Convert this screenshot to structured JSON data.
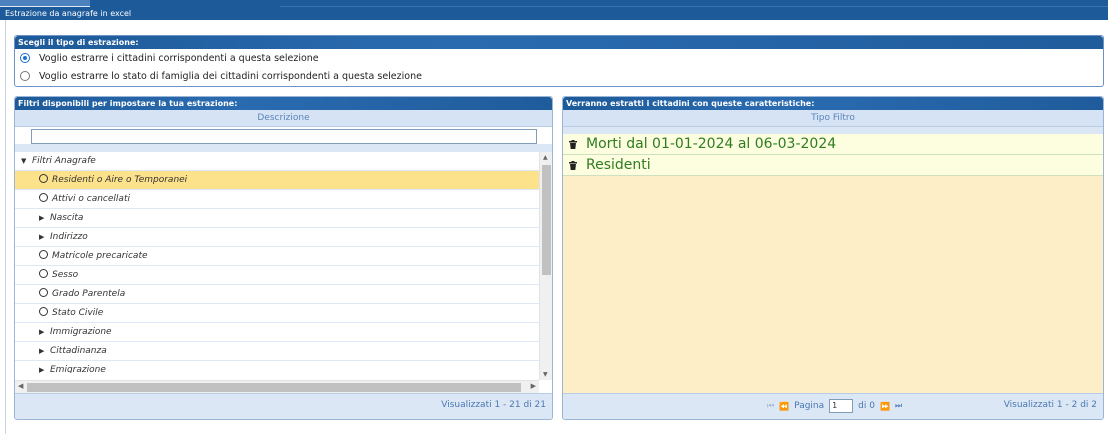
{
  "window": {
    "title": "Estrazione da anagrafe in excel"
  },
  "extraction": {
    "header": "Scegli il tipo di estrazione:",
    "options": [
      {
        "label": "Voglio estrarre i cittadini corrispondenti a questa selezione",
        "selected": true
      },
      {
        "label": "Voglio estrarre lo stato di famiglia dei cittadini corrispondenti a questa selezione",
        "selected": false
      }
    ]
  },
  "left_panel": {
    "header": "Filtri disponibili per impostare la tua estrazione:",
    "column": "Descrizione",
    "filter_value": "",
    "tree": [
      {
        "label": "Filtri Anagrafe",
        "kind": "group-open",
        "level": 0
      },
      {
        "label": "Residenti o Aire o Temporanei",
        "kind": "radio",
        "level": 1,
        "selected": true
      },
      {
        "label": "Attivi o cancellati",
        "kind": "radio",
        "level": 1
      },
      {
        "label": "Nascita",
        "kind": "group",
        "level": 1
      },
      {
        "label": "Indirizzo",
        "kind": "group",
        "level": 1
      },
      {
        "label": "Matricole precaricate",
        "kind": "radio",
        "level": 1
      },
      {
        "label": "Sesso",
        "kind": "radio",
        "level": 1
      },
      {
        "label": "Grado Parentela",
        "kind": "radio",
        "level": 1
      },
      {
        "label": "Stato Civile",
        "kind": "radio",
        "level": 1
      },
      {
        "label": "Immigrazione",
        "kind": "group",
        "level": 1
      },
      {
        "label": "Cittadinanza",
        "kind": "group",
        "level": 1
      },
      {
        "label": "Emigrazione",
        "kind": "group",
        "level": 1
      }
    ],
    "footer_count": "Visualizzati 1 - 21 di 21"
  },
  "right_panel": {
    "header": "Verranno estratti i cittadini con queste caratteristiche:",
    "column": "Tipo Filtro",
    "rows": [
      {
        "label": "Morti dal 01-01-2024 al 06-03-2024"
      },
      {
        "label": "Residenti"
      }
    ],
    "pager": {
      "page_label": "Pagina",
      "page_value": "1",
      "of_label": "di 0"
    },
    "footer_count": "Visualizzati 1 - 2 di 2"
  },
  "colors": {
    "header_blue": "#1d5a99",
    "selected_row": "#fde28c",
    "green_text": "#2f7d1f",
    "panel_bg": "#fdeec8"
  }
}
